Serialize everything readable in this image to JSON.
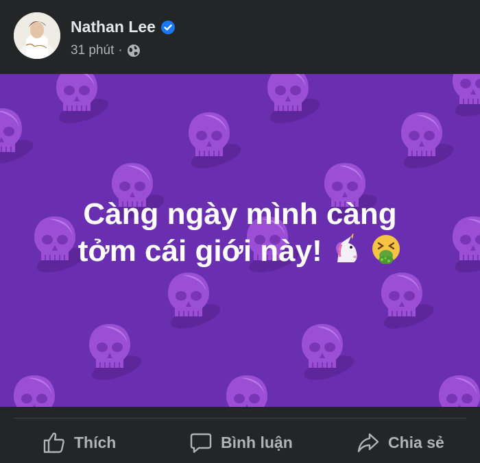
{
  "post": {
    "author_name": "Nathan Lee",
    "timestamp": "31 phút",
    "separator": "·",
    "audience_icon": "globe-icon",
    "verified_icon": "verified-badge-icon",
    "text_line_1": "Càng ngày mình càng",
    "text_line_2": "tởm cái giới này!",
    "emojis": [
      "unicorn-icon",
      "vomiting-face-icon"
    ],
    "background_color": "#6a2fb0"
  },
  "actions": {
    "like_label": "Thích",
    "comment_label": "Bình luận",
    "share_label": "Chia sẻ"
  },
  "colors": {
    "page_bg": "#242526",
    "accent_blue": "#1877f2",
    "muted_text": "#b0b3b8"
  }
}
